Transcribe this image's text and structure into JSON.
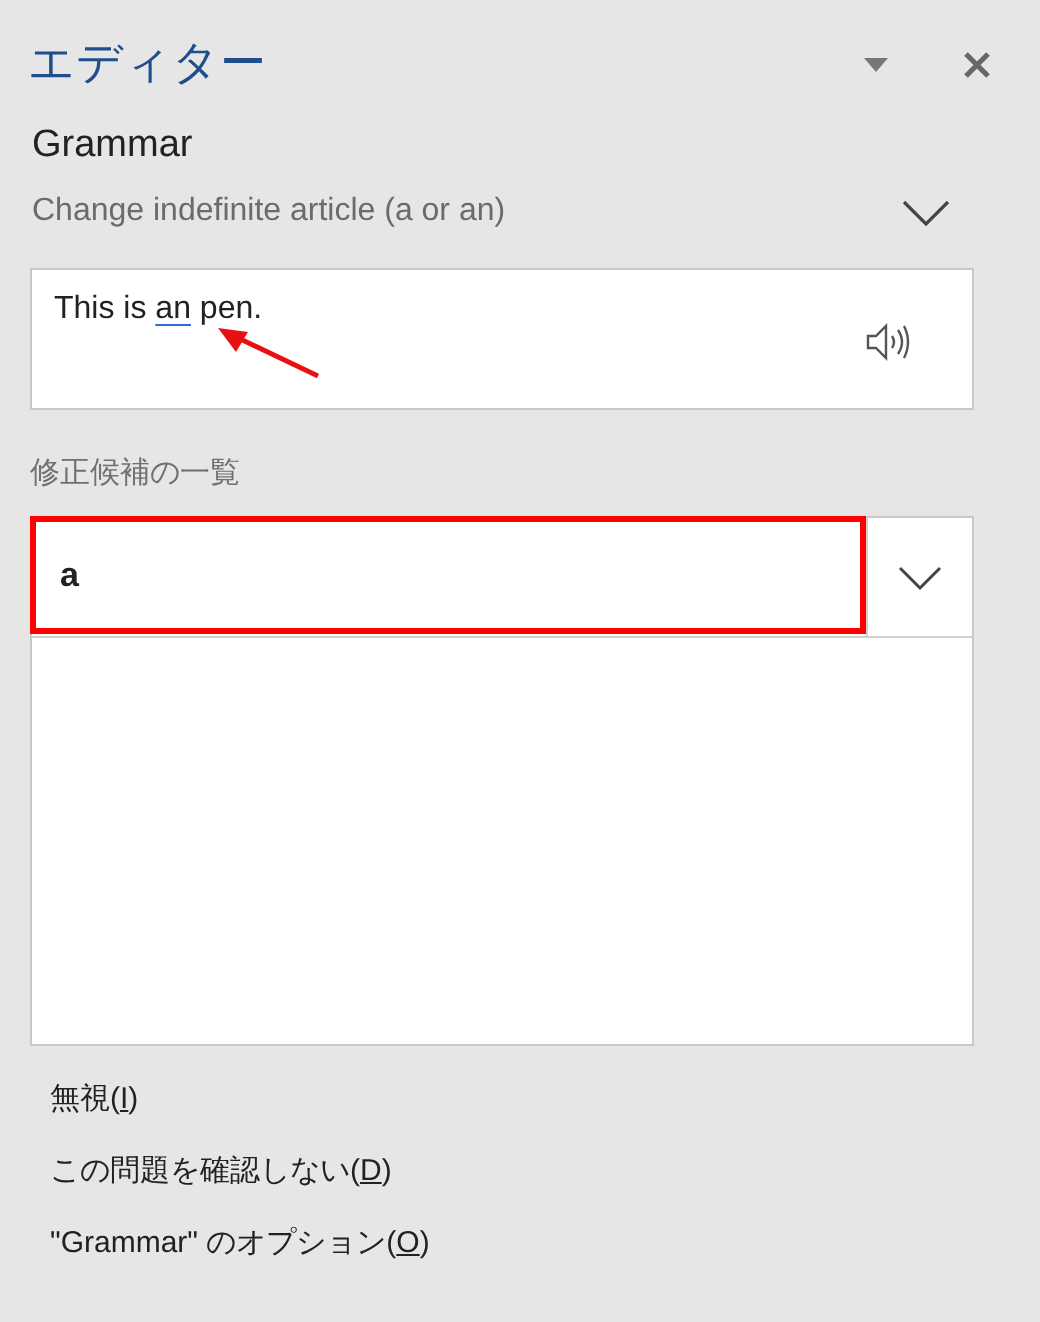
{
  "pane": {
    "title": "エディター"
  },
  "issue": {
    "category": "Grammar",
    "description": "Change indefinite article (a or an)",
    "expanded": false
  },
  "sentence": {
    "before": "This is ",
    "flagged": "an",
    "after": " pen.",
    "annotation_arrow": true
  },
  "suggestions": {
    "label": "修正候補の一覧",
    "items": [
      {
        "text": "a",
        "annotation_box": true
      }
    ]
  },
  "actions": [
    {
      "text": "無視(",
      "key": "I",
      "end": ")"
    },
    {
      "text": "この問題を確認しない(",
      "key": "D",
      "end": ")"
    },
    {
      "text": "\"Grammar\" のオプション(",
      "key": "O",
      "end": ")"
    }
  ]
}
